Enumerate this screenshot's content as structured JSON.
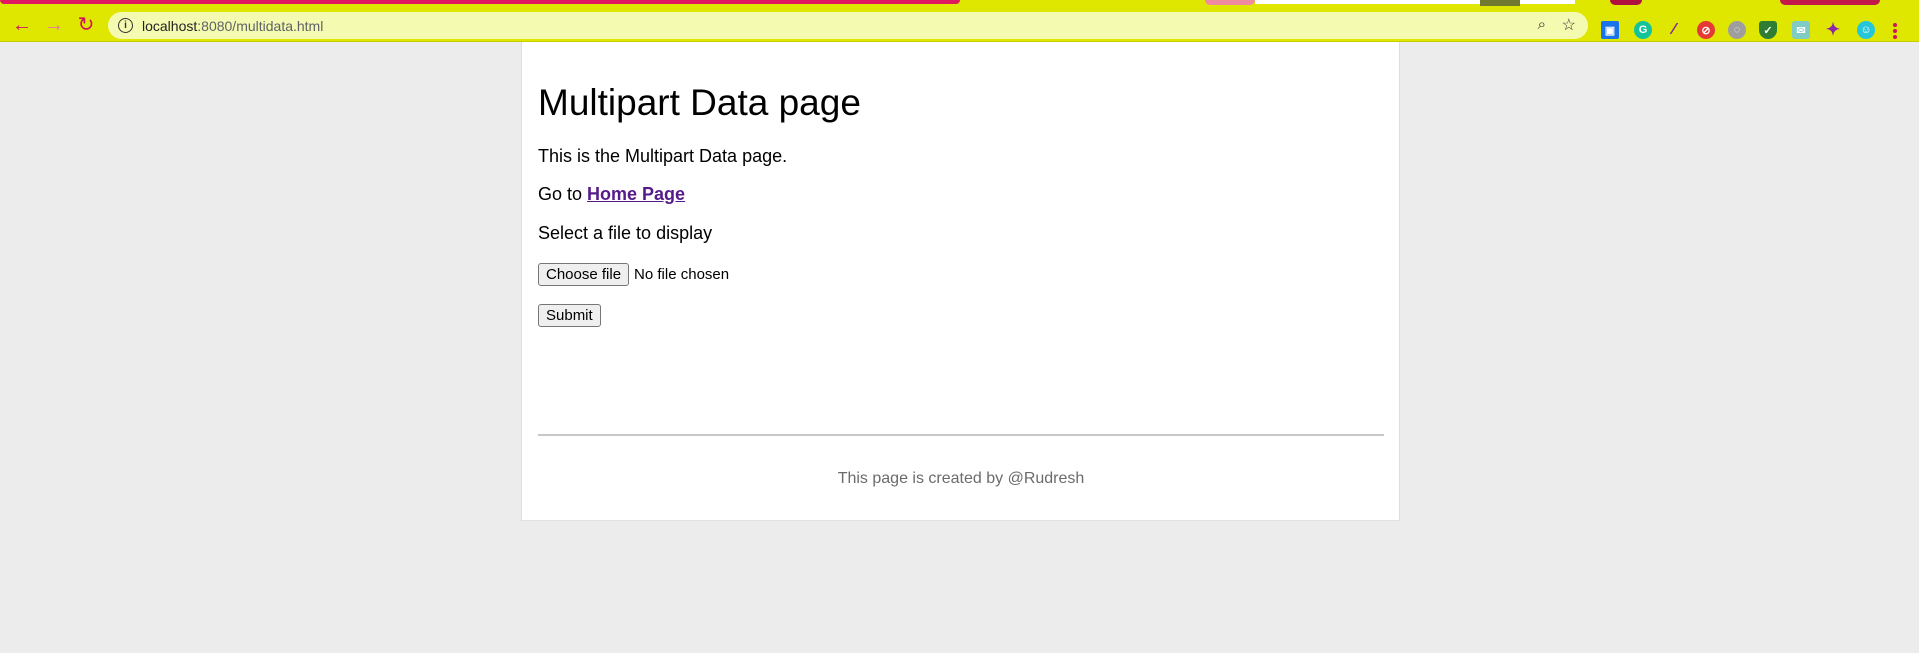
{
  "browser": {
    "url_host": "localhost",
    "url_path": ":8080/multidata.html",
    "icons": {
      "back": "arrow-left-icon",
      "forward": "arrow-right-icon",
      "reload": "reload-icon",
      "info": "info-icon",
      "zoom": "zoom-icon",
      "bookmark": "star-icon",
      "menu": "kebab-menu-icon"
    },
    "accent_color": "#dfe600",
    "icon_color": "#d0145a"
  },
  "page": {
    "title": "Multipart Data page",
    "intro": "This is the Multipart Data page.",
    "goto_prefix": "Go to ",
    "home_link": "Home Page",
    "select_prompt": "Select a file to display",
    "choose_file_label": "Choose file",
    "file_status": "No file chosen",
    "submit_label": "Submit",
    "footer": "This page is created by @Rudresh"
  }
}
